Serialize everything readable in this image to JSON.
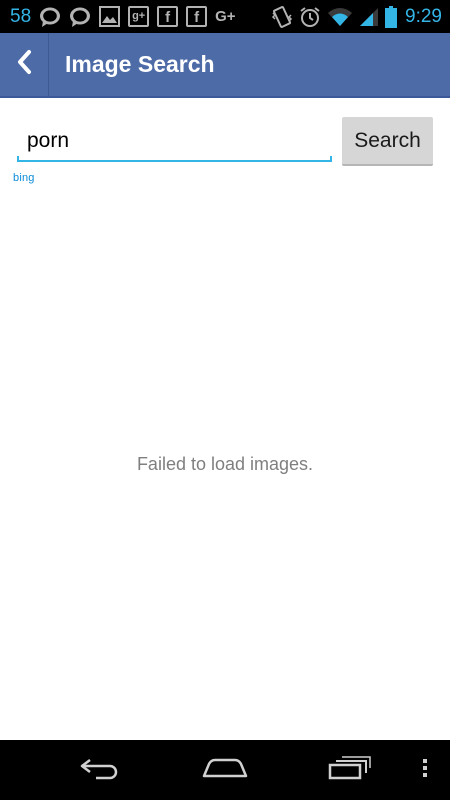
{
  "status_bar": {
    "notification_count": "58",
    "left_icons": [
      "chat-bubble-icon",
      "chat-bubble-icon",
      "image-icon",
      "google-plus-icon",
      "facebook-icon",
      "facebook-icon",
      "google-plus-icon"
    ],
    "gplus_box_label": "g+",
    "fb_label": "f",
    "gplus_label": "G+",
    "right_icons": [
      "vibrate-icon",
      "alarm-icon",
      "wifi-icon",
      "signal-icon",
      "battery-icon"
    ],
    "time": "9:29",
    "accent_color": "#33b5e5"
  },
  "action_bar": {
    "title": "Image Search",
    "back_icon": "chevron-left-icon",
    "color": "#4d6ba7"
  },
  "search": {
    "query": "porn",
    "button_label": "Search",
    "provider": "bing"
  },
  "content": {
    "message": "Failed to load images."
  },
  "nav_bar": {
    "icons": [
      "back-icon",
      "home-icon",
      "recent-apps-icon",
      "menu-icon"
    ]
  }
}
